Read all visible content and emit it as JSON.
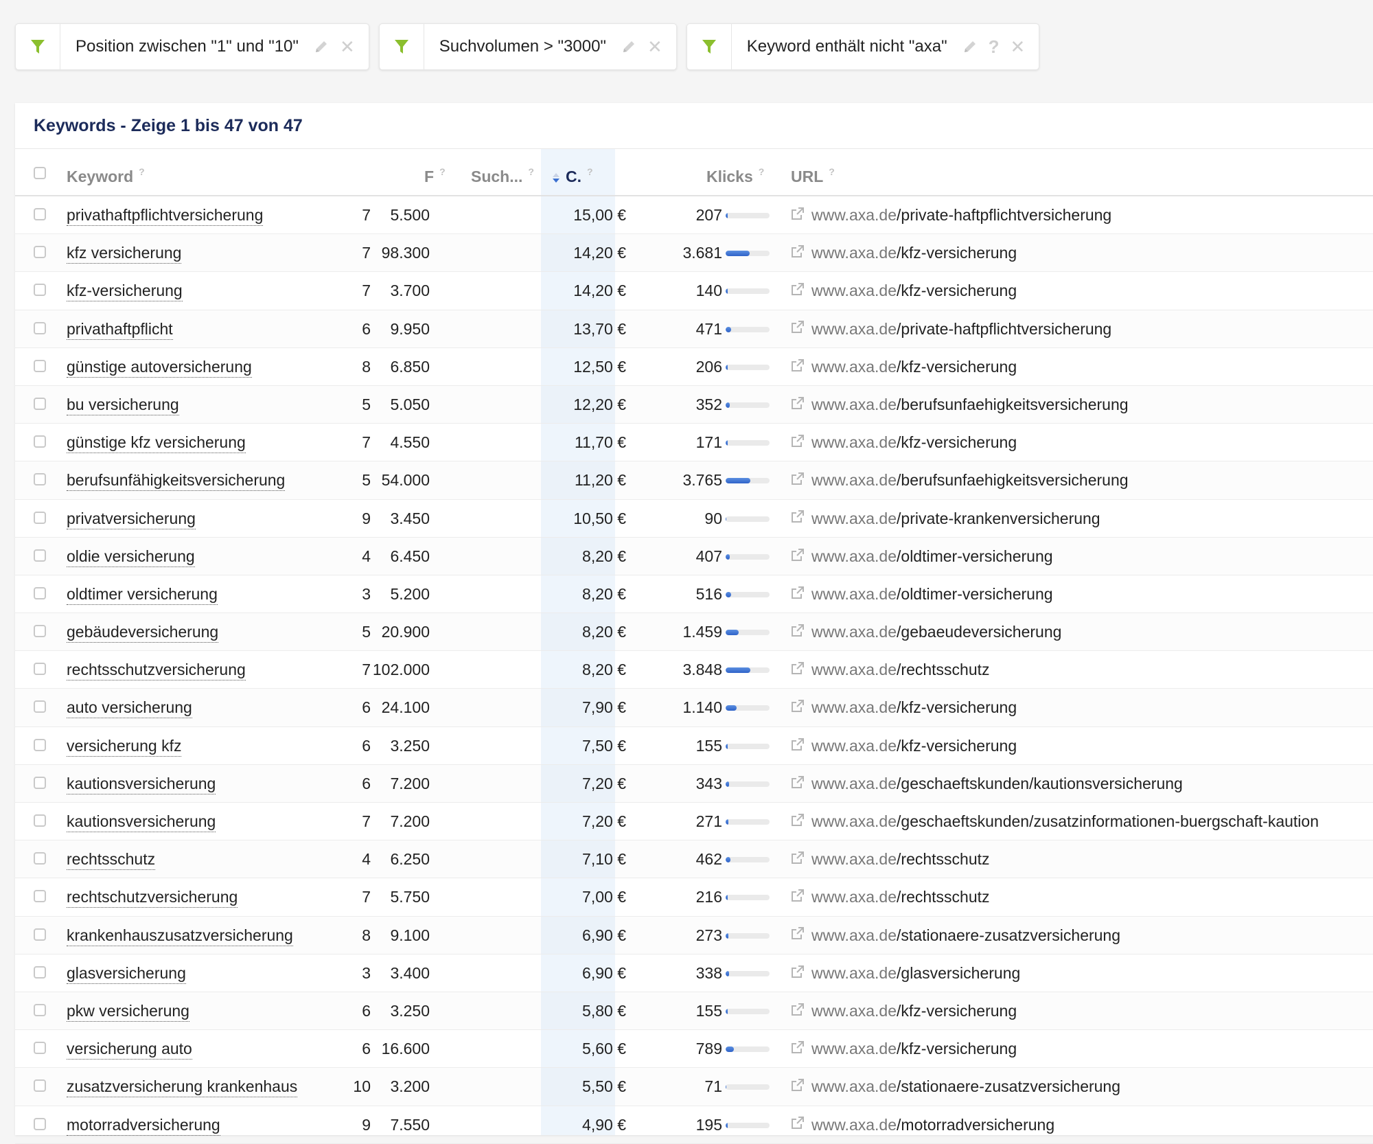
{
  "filters": [
    {
      "text": "Position zwischen \"1\" und \"10\"",
      "has_help": false
    },
    {
      "text": "Suchvolumen > \"3000\"",
      "has_help": false
    },
    {
      "text": "Keyword enthält nicht \"axa\"",
      "has_help": true
    }
  ],
  "colors": {
    "filter_icon": "#8bbf2e",
    "title": "#1c2b5a",
    "bar": "#3a6fd0",
    "sort_column_bg": "#eef5fc"
  },
  "table": {
    "title": "Keywords - Zeige 1 bis 47 von 47",
    "help_mark": "?",
    "columns": {
      "keyword": "Keyword",
      "position": "F",
      "volume": "Such...",
      "cpc": "C.",
      "clicks": "Klicks",
      "url": "URL"
    },
    "domain": "www.axa.de",
    "rows": [
      {
        "keyword": "privathaftpflichtversicherung",
        "position": "7",
        "volume": "5.500",
        "cpc": "15,00 €",
        "clicks": "207",
        "click_share": 0.05,
        "path": "/private-haftpflichtversicherung"
      },
      {
        "keyword": "kfz versicherung",
        "position": "7",
        "volume": "98.300",
        "cpc": "14,20 €",
        "clicks": "3.681",
        "click_share": 0.55,
        "path": "/kfz-versicherung"
      },
      {
        "keyword": "kfz-versicherung",
        "position": "7",
        "volume": "3.700",
        "cpc": "14,20 €",
        "clicks": "140",
        "click_share": 0.04,
        "path": "/kfz-versicherung"
      },
      {
        "keyword": "privathaftpflicht",
        "position": "6",
        "volume": "9.950",
        "cpc": "13,70 €",
        "clicks": "471",
        "click_share": 0.12,
        "path": "/private-haftpflichtversicherung"
      },
      {
        "keyword": "günstige autoversicherung",
        "position": "8",
        "volume": "6.850",
        "cpc": "12,50 €",
        "clicks": "206",
        "click_share": 0.05,
        "path": "/kfz-versicherung"
      },
      {
        "keyword": "bu versicherung",
        "position": "5",
        "volume": "5.050",
        "cpc": "12,20 €",
        "clicks": "352",
        "click_share": 0.09,
        "path": "/berufsunfaehigkeitsversicherung"
      },
      {
        "keyword": "günstige kfz versicherung",
        "position": "7",
        "volume": "4.550",
        "cpc": "11,70 €",
        "clicks": "171",
        "click_share": 0.04,
        "path": "/kfz-versicherung"
      },
      {
        "keyword": "berufsunfähigkeitsversicherung",
        "position": "5",
        "volume": "54.000",
        "cpc": "11,20 €",
        "clicks": "3.765",
        "click_share": 0.56,
        "path": "/berufsunfaehigkeitsversicherung"
      },
      {
        "keyword": "privatversicherung",
        "position": "9",
        "volume": "3.450",
        "cpc": "10,50 €",
        "clicks": "90",
        "click_share": 0.02,
        "path": "/private-krankenversicherung"
      },
      {
        "keyword": "oldie versicherung",
        "position": "4",
        "volume": "6.450",
        "cpc": "8,20 €",
        "clicks": "407",
        "click_share": 0.1,
        "path": "/oldtimer-versicherung"
      },
      {
        "keyword": "oldtimer versicherung",
        "position": "3",
        "volume": "5.200",
        "cpc": "8,20 €",
        "clicks": "516",
        "click_share": 0.12,
        "path": "/oldtimer-versicherung"
      },
      {
        "keyword": "gebäudeversicherung",
        "position": "5",
        "volume": "20.900",
        "cpc": "8,20 €",
        "clicks": "1.459",
        "click_share": 0.3,
        "path": "/gebaeudeversicherung"
      },
      {
        "keyword": "rechtsschutzversicherung",
        "position": "7",
        "volume": "102.000",
        "cpc": "8,20 €",
        "clicks": "3.848",
        "click_share": 0.57,
        "path": "/rechtsschutz"
      },
      {
        "keyword": "auto versicherung",
        "position": "6",
        "volume": "24.100",
        "cpc": "7,90 €",
        "clicks": "1.140",
        "click_share": 0.25,
        "path": "/kfz-versicherung"
      },
      {
        "keyword": "versicherung kfz",
        "position": "6",
        "volume": "3.250",
        "cpc": "7,50 €",
        "clicks": "155",
        "click_share": 0.04,
        "path": "/kfz-versicherung"
      },
      {
        "keyword": "kautionsversicherung",
        "position": "6",
        "volume": "7.200",
        "cpc": "7,20 €",
        "clicks": "343",
        "click_share": 0.08,
        "path": "/geschaeftskunden/kautionsversicherung"
      },
      {
        "keyword": "kautionsversicherung",
        "position": "7",
        "volume": "7.200",
        "cpc": "7,20 €",
        "clicks": "271",
        "click_share": 0.07,
        "path": "/geschaeftskunden/zusatzinformationen-buergschaft-kaution"
      },
      {
        "keyword": "rechtsschutz",
        "position": "4",
        "volume": "6.250",
        "cpc": "7,10 €",
        "clicks": "462",
        "click_share": 0.11,
        "path": "/rechtsschutz"
      },
      {
        "keyword": "rechtschutzversicherung",
        "position": "7",
        "volume": "5.750",
        "cpc": "7,00 €",
        "clicks": "216",
        "click_share": 0.05,
        "path": "/rechtsschutz"
      },
      {
        "keyword": "krankenhauszusatzversicherung",
        "position": "8",
        "volume": "9.100",
        "cpc": "6,90 €",
        "clicks": "273",
        "click_share": 0.07,
        "path": "/stationaere-zusatzversicherung"
      },
      {
        "keyword": "glasversicherung",
        "position": "3",
        "volume": "3.400",
        "cpc": "6,90 €",
        "clicks": "338",
        "click_share": 0.08,
        "path": "/glasversicherung"
      },
      {
        "keyword": "pkw versicherung",
        "position": "6",
        "volume": "3.250",
        "cpc": "5,80 €",
        "clicks": "155",
        "click_share": 0.04,
        "path": "/kfz-versicherung"
      },
      {
        "keyword": "versicherung auto",
        "position": "6",
        "volume": "16.600",
        "cpc": "5,60 €",
        "clicks": "789",
        "click_share": 0.18,
        "path": "/kfz-versicherung"
      },
      {
        "keyword": "zusatzversicherung krankenhaus",
        "position": "10",
        "volume": "3.200",
        "cpc": "5,50 €",
        "clicks": "71",
        "click_share": 0.02,
        "path": "/stationaere-zusatzversicherung"
      },
      {
        "keyword": "motorradversicherung",
        "position": "9",
        "volume": "7.550",
        "cpc": "4,90 €",
        "clicks": "195",
        "click_share": 0.05,
        "path": "/motorradversicherung"
      }
    ]
  }
}
